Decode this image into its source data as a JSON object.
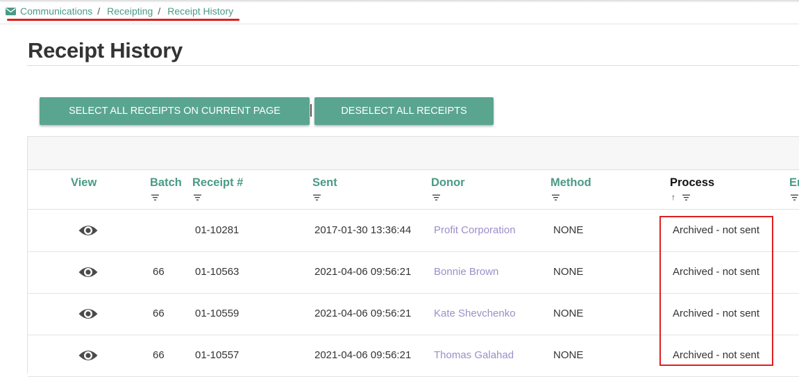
{
  "breadcrumb": {
    "icon": "envelope-icon",
    "items": [
      "Communications",
      "Receipting",
      "Receipt History"
    ],
    "separator": "/"
  },
  "page": {
    "title": "Receipt History"
  },
  "actions": {
    "select_all": "SELECT ALL RECEIPTS ON CURRENT PAGE",
    "deselect_all": "DESELECT ALL RECEIPTS",
    "divider": "|"
  },
  "table": {
    "columns": {
      "view": "View",
      "batch": "Batch",
      "receipt": "Receipt #",
      "sent": "Sent",
      "donor": "Donor",
      "method": "Method",
      "process": "Process",
      "email": "Em"
    },
    "sort": {
      "column": "Process",
      "direction": "ascending",
      "glyph": "↑"
    },
    "rows": [
      {
        "batch": "",
        "receipt": "01-10281",
        "sent": "2017-01-30 13:36:44",
        "donor": "Profit Corporation",
        "method": "NONE",
        "process": "Archived - not sent"
      },
      {
        "batch": "66",
        "receipt": "01-10563",
        "sent": "2021-04-06 09:56:21",
        "donor": "Bonnie Brown",
        "method": "NONE",
        "process": "Archived - not sent"
      },
      {
        "batch": "66",
        "receipt": "01-10559",
        "sent": "2021-04-06 09:56:21",
        "donor": "Kate Shevchenko",
        "method": "NONE",
        "process": "Archived - not sent"
      },
      {
        "batch": "66",
        "receipt": "01-10557",
        "sent": "2021-04-06 09:56:21",
        "donor": "Thomas Galahad",
        "method": "NONE",
        "process": "Archived - not sent"
      }
    ]
  },
  "colors": {
    "accent": "#4a9a86",
    "button": "#5aa590",
    "donor_link": "#9c8ec8",
    "annotation": "#dd1f1f"
  }
}
